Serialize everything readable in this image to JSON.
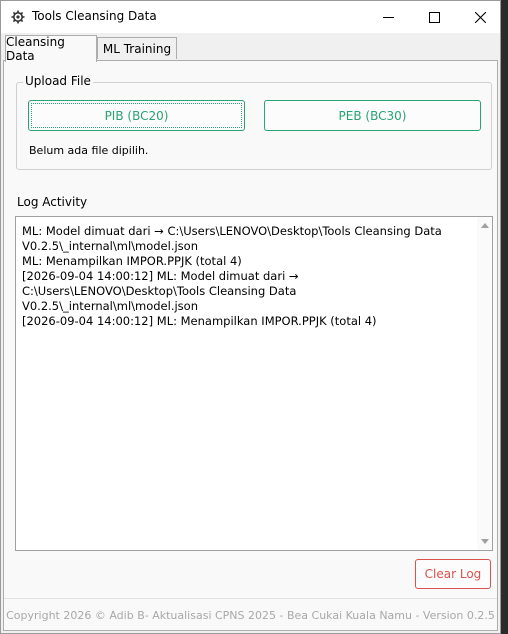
{
  "window": {
    "title": "Tools Cleansing Data",
    "minimize_icon": "minimize-icon",
    "maximize_icon": "maximize-icon",
    "close_icon": "close-icon"
  },
  "tabs": [
    {
      "label": "Cleansing Data",
      "active": true
    },
    {
      "label": "ML Training",
      "active": false
    }
  ],
  "upload": {
    "group_label": "Upload File",
    "pib_button": "PIB (BC20)",
    "peb_button": "PEB (BC30)",
    "status": "Belum ada file dipilih."
  },
  "log": {
    "label": "Log Activity",
    "lines": [
      "ML: Model dimuat dari → C:\\Users\\LENOVO\\Desktop\\Tools Cleansing Data V0.2.5\\_internal\\ml\\model.json",
      "ML: Menampilkan IMPOR.PPJK (total 4)",
      "[2026-09-04 14:00:12] ML: Model dimuat dari → C:\\Users\\LENOVO\\Desktop\\Tools Cleansing Data V0.2.5\\_internal\\ml\\model.json",
      "[2026-09-04 14:00:12] ML: Menampilkan IMPOR.PPJK (total 4)"
    ],
    "clear_button": "Clear Log"
  },
  "footer": "Copyright 2026 © Adib B- Aktualisasi CPNS 2025 - Bea Cukai Kuala Namu - Version 0.2.5",
  "colors": {
    "accent_green": "#2aa374",
    "accent_red": "#d9534f"
  }
}
